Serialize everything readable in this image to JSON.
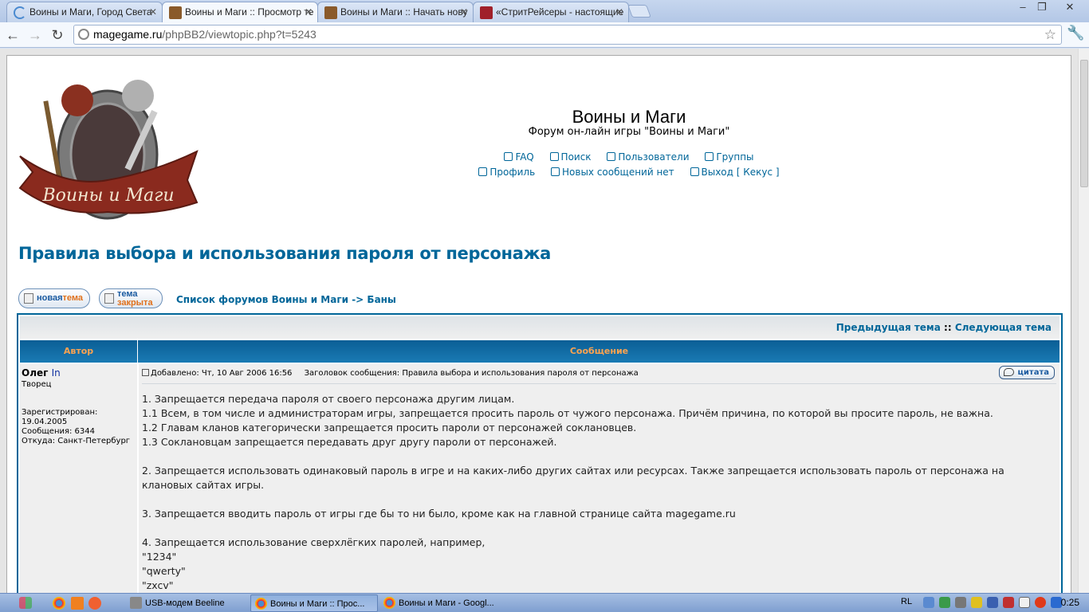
{
  "browser": {
    "tabs": [
      {
        "label": "Воины и Маги, Город Света",
        "active": false
      },
      {
        "label": "Воины и Маги :: Просмотр те",
        "active": true
      },
      {
        "label": "Воины и Маги :: Начать нову",
        "active": false
      },
      {
        "label": "«СтритРейсеры - настоящие",
        "active": false
      }
    ],
    "tab_close": "✕",
    "window_controls": {
      "minimize": "–",
      "maximize": "❐",
      "close": "✕"
    },
    "nav": {
      "back": "←",
      "forward": "→",
      "reload": "↻",
      "menu": "🔧"
    },
    "url_host": "magegame.ru",
    "url_path": "/phpBB2/viewtopic.php?t=5243",
    "star": "☆"
  },
  "site": {
    "title": "Воины и Маги",
    "description": "Форум он-лайн игры \"Воины и Маги\"",
    "logo_text": "Воины и Маги",
    "menu_row1": [
      "FAQ",
      "Поиск",
      "Пользователи",
      "Группы"
    ],
    "menu_row2": [
      "Профиль",
      "Новых сообщений нет",
      "Выход [ Кекус ]"
    ]
  },
  "topic": {
    "title": "Правила выбора и использования пароля от персонажа",
    "new_topic_btn": {
      "part1": "новая",
      "part2": "тема"
    },
    "locked_btn": {
      "part1": "тема",
      "part2": "закрыта"
    },
    "breadcrumb_forum": "Список форумов Воины и Маги",
    "breadcrumb_sep": "->",
    "breadcrumb_section": "Баны",
    "prev_topic": "Предыдущая тема",
    "nav_sep": "::",
    "next_topic": "Следующая тема",
    "col_author": "Автор",
    "col_message": "Сообщение"
  },
  "post": {
    "author": "Олег",
    "status": "In",
    "rank": "Творец",
    "registered": "Зарегистрирован: 19.04.2005",
    "messages": "Сообщения: 6344",
    "location": "Откуда: Санкт-Петербург",
    "posted": "Добавлено: Чт, 10 Авг 2006 16:56",
    "subject": "Заголовок сообщения: Правила выбора и использования пароля от персонажа",
    "quote_label": "цитата",
    "lines": [
      "1. Запрещается передача пароля от своего персонажа другим лицам.",
      "1.1 Всем, в том числе и администраторам игры, запрещается просить пароль от чужого персонажа. Причём причина, по которой вы просите пароль, не важна.",
      "1.2 Главам кланов категорически запрещается просить пароли от персонажей соклановцев.",
      "1.3 Соклановцам запрещается передавать друг другу пароли от персонажей.",
      "",
      "2. Запрещается использовать одинаковый пароль в игре и на каких-либо других сайтах или ресурсах. Также запрещается использовать пароль от персонажа на клановых сайтах игры.",
      "",
      "3. Запрещается вводить пароль от игры где бы то ни было, кроме как на главной странице сайта magegame.ru",
      "",
      "4. Запрещается использование сверхлёгких паролей, например,",
      "\"1234\"",
      "\"qwerty\"",
      "\"zxcv\""
    ]
  },
  "taskbar": {
    "tasks": [
      {
        "label": "USB-модем Beeline",
        "active": false
      },
      {
        "label": "Воины и Маги :: Прос...",
        "active": true
      },
      {
        "label": "Воины и Маги - Googl...",
        "active": false
      }
    ],
    "lang": "RL",
    "clock": "0:25"
  },
  "colors": {
    "link": "#006699",
    "accent_orange": "#ffa34f",
    "header_blue": "#0a5e95"
  }
}
